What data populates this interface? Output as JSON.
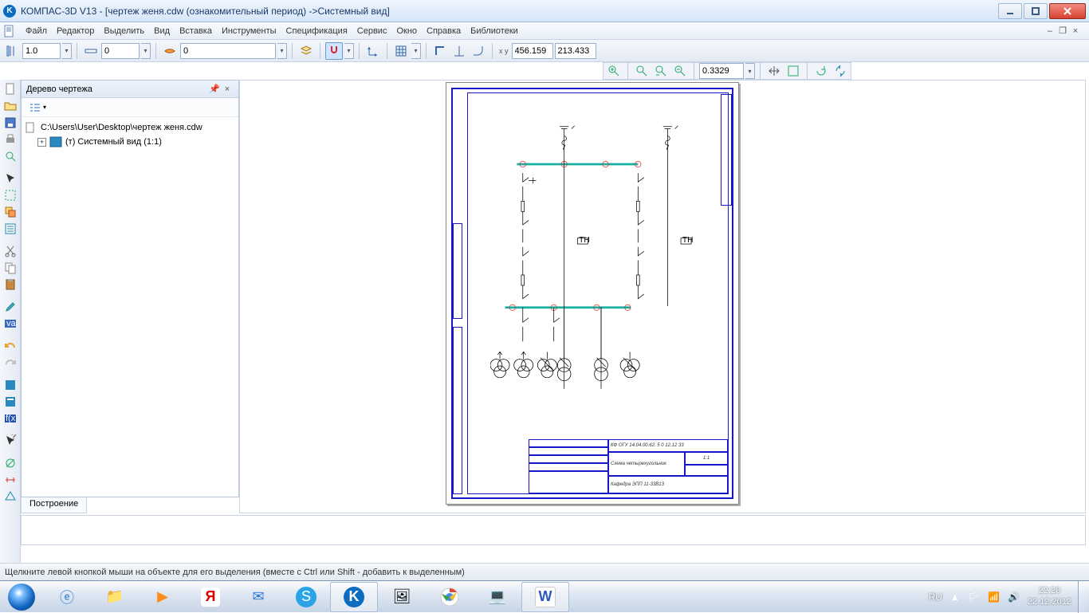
{
  "titlebar": {
    "text": "КОМПАС-3D V13 - [чертеж женя.cdw (ознакомительный период) ->Системный вид]"
  },
  "menu": {
    "items": [
      "Файл",
      "Редактор",
      "Выделить",
      "Вид",
      "Вставка",
      "Инструменты",
      "Спецификация",
      "Сервис",
      "Окно",
      "Справка",
      "Библиотеки"
    ],
    "underlines": [
      0,
      0,
      2,
      0,
      2,
      0,
      0,
      0,
      0,
      1,
      0
    ]
  },
  "toolbar": {
    "step_value": "1.0",
    "style_value": "0",
    "layer_value": "0",
    "coord_x": "456.159",
    "coord_y": "213.433",
    "zoom_value": "0.3329"
  },
  "sidepanel": {
    "title": "Дерево чертежа",
    "file_path": "C:\\Users\\User\\Desktop\\чертеж женя.cdw",
    "node_system_view": "(т) Системный вид (1:1)",
    "tab": "Построение"
  },
  "titleblock": {
    "code": "КФ ОГУ 14.04.00.62. 5 0  12.12  33",
    "name": "Схема четырехугольник",
    "scale": "1:1",
    "dept": "Кафедра ЭПП  11-33В13"
  },
  "status": {
    "hint": "Щелкните левой кнопкой мыши на объекте для его выделения (вместе с Ctrl или Shift - добавить к выделенным)"
  },
  "tray": {
    "lang": "RU",
    "time": "22:20",
    "date": "22.12.2012"
  }
}
